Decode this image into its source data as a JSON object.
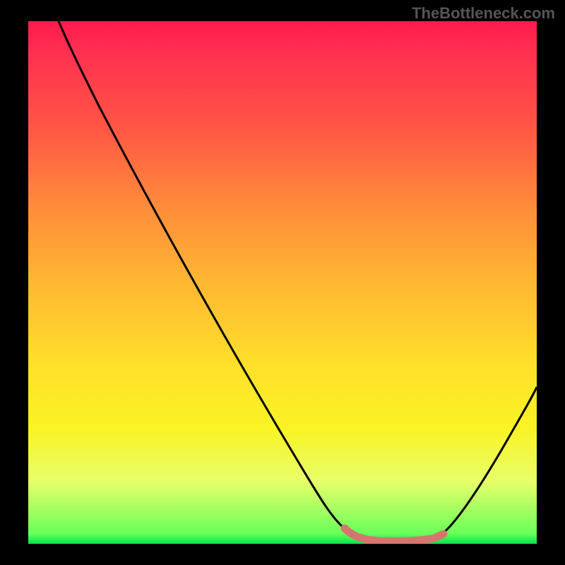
{
  "watermark": "TheBottleneck.com",
  "chart_data": {
    "type": "line",
    "title": "",
    "xlabel": "",
    "ylabel": "",
    "xlim": [
      0,
      100
    ],
    "ylim": [
      0,
      100
    ],
    "background_gradient": {
      "top": "#ff1a4d",
      "bottom": "#00e54a",
      "meaning": "bottleneck severity (red=high, green=low)"
    },
    "series": [
      {
        "name": "bottleneck-curve",
        "color": "#000000",
        "x": [
          6,
          12,
          20,
          30,
          40,
          50,
          58,
          62,
          66,
          72,
          78,
          84,
          90,
          96,
          100
        ],
        "y": [
          100,
          92,
          80,
          64,
          48,
          32,
          18,
          8,
          2,
          0,
          0,
          2,
          10,
          22,
          30
        ]
      },
      {
        "name": "optimal-range-highlight",
        "color": "#d5766e",
        "x": [
          62,
          66,
          72,
          78,
          82
        ],
        "y": [
          3,
          1,
          0,
          1,
          3
        ]
      }
    ],
    "annotations": []
  }
}
